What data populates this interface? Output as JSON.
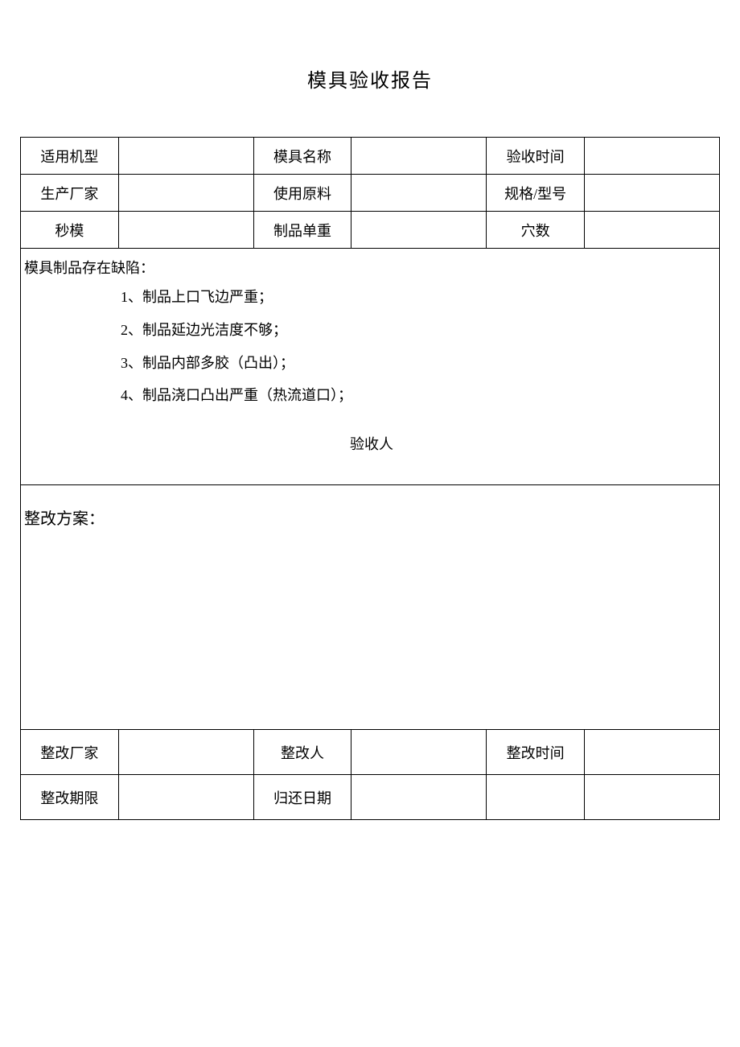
{
  "title": "模具验收报告",
  "header_row1": {
    "label1": "适用机型",
    "value1": "",
    "label2": "模具名称",
    "value2": "",
    "label3": "验收时间",
    "value3": ""
  },
  "header_row2": {
    "label1": "生产厂家",
    "value1": "",
    "label2": "使用原料",
    "value2": "",
    "label3": "规格/型号",
    "value3": ""
  },
  "header_row3": {
    "label1": "秒模",
    "value1": "",
    "label2": "制品单重",
    "value2": "",
    "label3": "穴数",
    "value3": ""
  },
  "defects": {
    "heading": "模具制品存在缺陷：",
    "items": [
      "1、制品上口飞边严重；",
      "2、制品延边光洁度不够；",
      "3、制品内部多胶（凸出）；",
      "4、制品浇口凸出严重（热流道口）；"
    ],
    "inspector_label": "验收人"
  },
  "rectification": {
    "heading": "整改方案："
  },
  "footer_row1": {
    "label1": "整改厂家",
    "value1": "",
    "label2": "整改人",
    "value2": "",
    "label3": "整改时间",
    "value3": ""
  },
  "footer_row2": {
    "label1": "整改期限",
    "value1": "",
    "label2": "归还日期",
    "value2": "",
    "label3": "",
    "value3": ""
  }
}
